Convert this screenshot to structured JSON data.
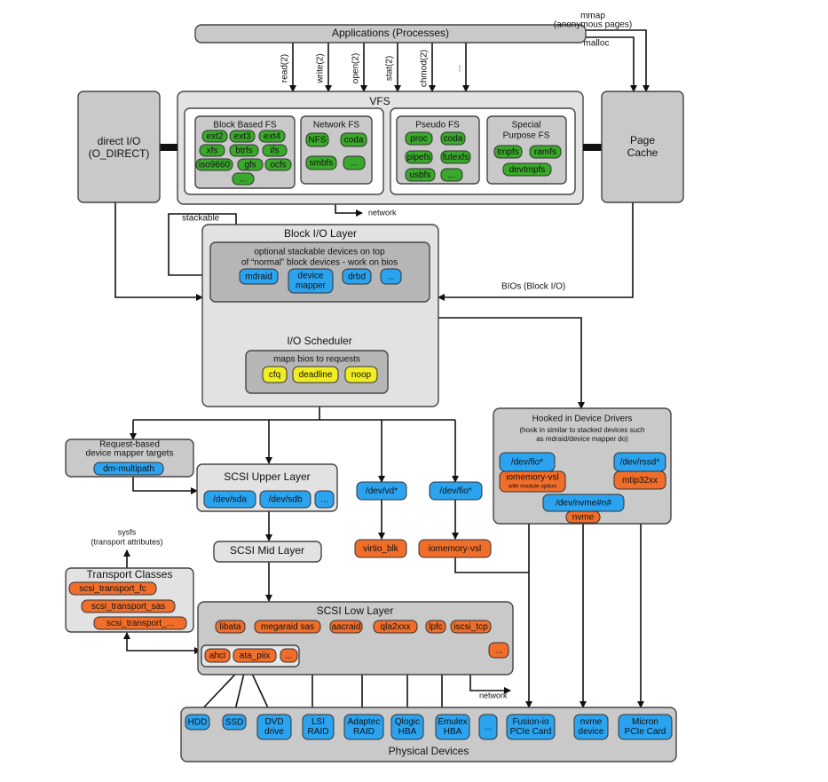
{
  "applications": "Applications (Processes)",
  "syscalls": [
    "read(2)",
    "write(2)",
    "open(2)",
    "stat(2)",
    "chmod(2)",
    "..."
  ],
  "mmap": [
    "mmap",
    "(anonymous pages)"
  ],
  "malloc": "malloc",
  "vfs": {
    "title": "VFS",
    "block_fs": {
      "title": "Block Based FS",
      "items": [
        "ext2",
        "ext3",
        "ext4",
        "xfs",
        "btrfs",
        "ifs",
        "iso9660",
        "gfs",
        "ocfs",
        "..."
      ]
    },
    "network_fs": {
      "title": "Network FS",
      "items": [
        "NFS",
        "coda",
        "smbfs",
        "..."
      ]
    },
    "pseudo_fs": {
      "title": "Pseudo FS",
      "items": [
        "proc",
        "coda",
        "pipefs",
        "futexfs",
        "usbfs",
        "..."
      ]
    },
    "special_fs": {
      "title": [
        "Special",
        "Purpose FS"
      ],
      "items": [
        "tmpfs",
        "ramfs",
        "devtmpfs"
      ]
    }
  },
  "vfs_network": "network",
  "direct_io": [
    "direct I/O",
    "(O_DIRECT)"
  ],
  "page_cache": [
    "Page",
    "Cache"
  ],
  "block_layer": {
    "title": "Block I/O Layer",
    "stackable_label": "stackable",
    "stackable_desc": [
      "optional stackable devices on top",
      "of “normal” block devices - work on bios"
    ],
    "devices": [
      "mdraid",
      [
        "device",
        "mapper"
      ],
      "drbd",
      "..."
    ],
    "scheduler_title": "I/O Scheduler",
    "scheduler_desc": "maps bios to requests",
    "schedulers": [
      "cfq",
      "deadline",
      "noop"
    ]
  },
  "bios_label": "BIOs (Block I/O)",
  "request_based": {
    "title": [
      "Request-based",
      "device mapper targets"
    ],
    "items": [
      "dm-multipath"
    ]
  },
  "scsi_upper": {
    "title": "SCSI Upper Layer",
    "items": [
      "/dev/sda",
      "/dev/sdb",
      "..."
    ]
  },
  "virtio": {
    "dev": "/dev/vd*",
    "driver": "virtio_blk"
  },
  "fio": {
    "dev": "/dev/fio*",
    "driver": "iomemory-vsl"
  },
  "hooked": {
    "title": "Hooked in Device Drivers",
    "desc": [
      "(hook in similar to stacked devices such",
      "as mdraid/device mapper do)"
    ],
    "fio_dev": "/dev/fio*",
    "fio_driver": "iomemory-vsl",
    "fio_note": "with module option",
    "rssd_dev": "/dev/rssd*",
    "rssd_driver": "mtip32xx",
    "nvme_dev": "/dev/nvme#n#",
    "nvme_driver": "nvme"
  },
  "scsi_mid": "SCSI Mid Layer",
  "sysfs": [
    "sysfs",
    "(transport attributes)"
  ],
  "transport": {
    "title": "Transport Classes",
    "items": [
      "scsi_transport_fc",
      "scsi_transport_sas",
      "scsi_transport_..."
    ]
  },
  "scsi_low": {
    "title": "SCSI Low Layer",
    "drivers": [
      "libata",
      "megaraid sas",
      "aacraid",
      "qla2xxx",
      "lpfc",
      "iscsi_tcp",
      "..."
    ],
    "ata": [
      "ahci",
      "ata_piix",
      "..."
    ]
  },
  "low_network": "network",
  "physical": {
    "title": "Physical Devices",
    "devices": [
      "HDD",
      "SSD",
      [
        "DVD",
        "drive"
      ],
      [
        "LSI",
        "RAID"
      ],
      [
        "Adaptec",
        "RAID"
      ],
      [
        "Qlogic",
        "HBA"
      ],
      [
        "Emulex",
        "HBA"
      ],
      "...",
      [
        "Fusion-io",
        "PCIe Card"
      ],
      [
        "nvme",
        "device"
      ],
      [
        "Micron",
        "PCIe Card"
      ]
    ]
  },
  "colors": {
    "filesystem": "#3aa82a",
    "block_device": "#2ba3ee",
    "driver": "#f06e2a",
    "scheduler": "#f0ee22",
    "layer_gray": "#c9c9c9",
    "layer_light": "#e2e2e2"
  }
}
